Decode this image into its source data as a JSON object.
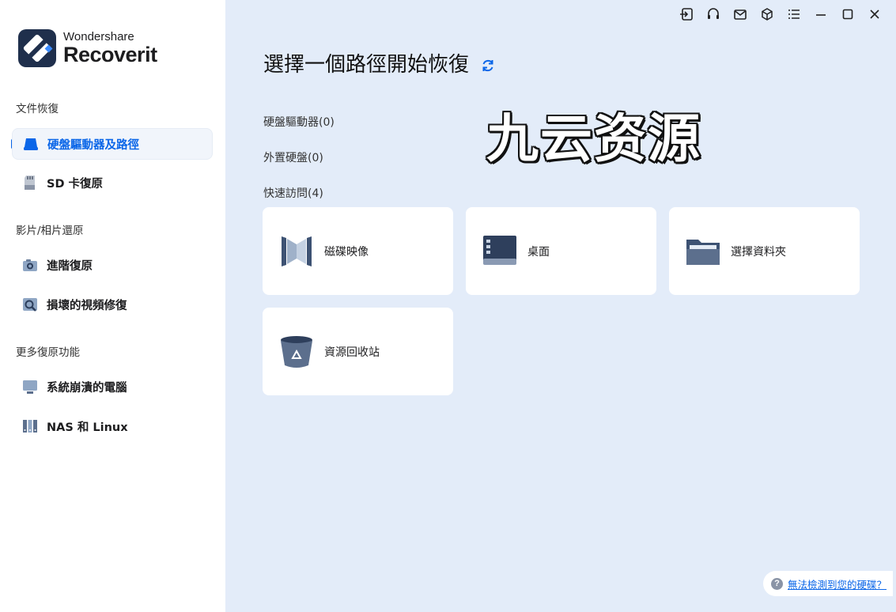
{
  "app": {
    "brand": "Wondershare",
    "product": "Recoverit"
  },
  "sidebar": {
    "sections": [
      {
        "title": "文件恢復"
      },
      {
        "title": "影片/相片還原"
      },
      {
        "title": "更多復原功能"
      }
    ],
    "items": [
      {
        "label": "硬盤驅動器及路徑",
        "icon": "hard-drive-icon",
        "active": true
      },
      {
        "label": "SD 卡復原",
        "icon": "sd-card-icon"
      },
      {
        "label": "進階復原",
        "icon": "camera-icon"
      },
      {
        "label": "損壞的視頻修復",
        "icon": "video-repair-icon"
      },
      {
        "label": "系統崩潰的電腦",
        "icon": "computer-icon"
      },
      {
        "label": "NAS 和 Linux",
        "icon": "nas-icon"
      }
    ]
  },
  "main": {
    "title": "選擇一個路徑開始恢復",
    "groups": {
      "hard_drives": "硬盤驅動器(0)",
      "external": "外置硬盤(0)",
      "quick_access": "快速訪問(4)"
    },
    "cards": [
      {
        "label": "磁碟映像",
        "icon": "disk-image-icon"
      },
      {
        "label": "桌面",
        "icon": "desktop-icon"
      },
      {
        "label": "選擇資料夾",
        "icon": "folder-icon"
      },
      {
        "label": "資源回收站",
        "icon": "recycle-bin-icon"
      }
    ],
    "watermark": "九云资源",
    "help_link": "無法檢測到您的硬碟？"
  },
  "colors": {
    "accent": "#0a66e8",
    "main_bg": "#e3ecf9",
    "dark": "#1f2f4c"
  }
}
